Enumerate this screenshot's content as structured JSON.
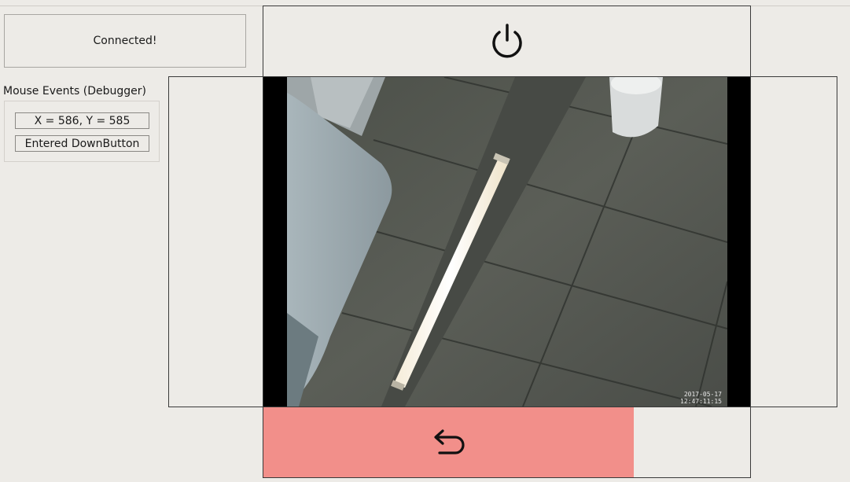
{
  "status": {
    "text": "Connected!"
  },
  "debugger": {
    "title": "Mouse Events (Debugger)",
    "coordinates": "X = 586, Y = 585",
    "event": "Entered DownButton"
  },
  "icons": {
    "power": "power-icon",
    "back": "return-arrow-icon"
  },
  "video": {
    "timestamp_date": "2017-05-17",
    "timestamp_time": "12:47:11:15"
  },
  "colors": {
    "back_button": "#f28f8a",
    "background": "#edebe7"
  }
}
